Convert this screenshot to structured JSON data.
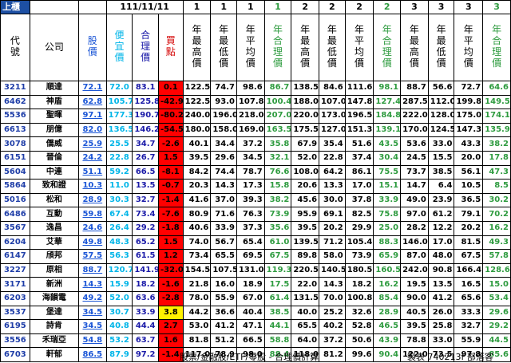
{
  "header": {
    "top_left": "上櫃",
    "date": "111/11/11",
    "groups": [
      {
        "num": "1",
        "cols": [
          "年最高價",
          "年最低價",
          "年平均價",
          "年合理價"
        ]
      },
      {
        "num": "2",
        "cols": [
          "年最高價",
          "年最低價",
          "年平均價",
          "年合理價"
        ]
      },
      {
        "num": "3",
        "cols": [
          "年最高價",
          "年最低價",
          "年平均價",
          "年合理價"
        ]
      }
    ],
    "group_nums": [
      "1",
      "1",
      "1",
      "1",
      "2",
      "2",
      "2",
      "2",
      "3",
      "3",
      "3",
      "3"
    ],
    "code": "代號",
    "company": "公司",
    "price": "股價",
    "cheap": "便宜價",
    "fair": "合理價",
    "signal": "買點"
  },
  "rows": [
    [
      "3211",
      "順達",
      "72.1",
      "72.0",
      "83.1",
      "0.1",
      "122.5",
      "74.7",
      "98.6",
      "86.7",
      "138.5",
      "84.6",
      "111.6",
      "98.1",
      "88.7",
      "56.6",
      "72.7",
      "64.6"
    ],
    [
      "6462",
      "神盾",
      "62.8",
      "105.7",
      "125.8",
      "-42.9",
      "122.5",
      "93.0",
      "107.8",
      "100.4",
      "188.0",
      "107.0",
      "147.8",
      "127.4",
      "287.5",
      "112.0",
      "199.8",
      "149.5"
    ],
    [
      "5536",
      "聖暉",
      "97.1",
      "177.3",
      "190.7",
      "-80.2",
      "240.0",
      "196.0",
      "218.0",
      "207.0",
      "220.0",
      "173.0",
      "196.5",
      "184.8",
      "222.0",
      "128.0",
      "175.0",
      "174.1"
    ],
    [
      "6613",
      "朋億",
      "82.0",
      "136.5",
      "146.2",
      "-54.5",
      "180.0",
      "158.0",
      "169.0",
      "163.5",
      "175.5",
      "127.0",
      "151.3",
      "139.1",
      "170.0",
      "124.5",
      "147.3",
      "135.9"
    ],
    [
      "3078",
      "僑威",
      "25.9",
      "25.5",
      "34.7",
      "-2.6",
      "40.1",
      "34.4",
      "37.2",
      "35.8",
      "67.9",
      "35.4",
      "51.6",
      "43.5",
      "53.6",
      "33.0",
      "43.3",
      "38.2"
    ],
    [
      "6151",
      "晉倫",
      "24.2",
      "22.8",
      "26.7",
      "1.5",
      "39.5",
      "29.6",
      "34.5",
      "32.1",
      "52.0",
      "22.8",
      "37.4",
      "30.4",
      "24.5",
      "15.5",
      "20.0",
      "17.8"
    ],
    [
      "5604",
      "中連",
      "51.1",
      "59.2",
      "66.5",
      "-8.1",
      "84.2",
      "74.4",
      "78.7",
      "76.6",
      "108.0",
      "64.2",
      "86.1",
      "75.5",
      "73.7",
      "38.5",
      "56.1",
      "47.3"
    ],
    [
      "5864",
      "致和證",
      "10.3",
      "11.0",
      "13.5",
      "-0.7",
      "20.3",
      "14.3",
      "17.3",
      "15.8",
      "20.6",
      "13.3",
      "17.0",
      "15.1",
      "14.7",
      "6.4",
      "10.5",
      "8.5"
    ],
    [
      "5016",
      "松和",
      "28.9",
      "30.3",
      "32.7",
      "-1.4",
      "41.6",
      "37.0",
      "39.3",
      "38.2",
      "45.6",
      "30.0",
      "37.8",
      "33.9",
      "49.0",
      "23.9",
      "36.5",
      "30.2"
    ],
    [
      "6486",
      "互動",
      "59.8",
      "67.4",
      "73.4",
      "-7.6",
      "80.9",
      "71.6",
      "76.3",
      "73.9",
      "95.9",
      "69.1",
      "82.5",
      "75.8",
      "97.0",
      "61.2",
      "79.1",
      "70.2"
    ],
    [
      "3567",
      "逸昌",
      "24.6",
      "26.4",
      "29.2",
      "-1.8",
      "40.6",
      "33.9",
      "37.3",
      "35.6",
      "39.5",
      "20.2",
      "29.9",
      "25.0",
      "28.2",
      "12.2",
      "20.2",
      "16.2"
    ],
    [
      "6204",
      "艾華",
      "49.8",
      "48.3",
      "65.2",
      "1.5",
      "74.0",
      "56.7",
      "65.4",
      "61.0",
      "139.5",
      "71.2",
      "105.4",
      "88.3",
      "146.0",
      "17.0",
      "81.5",
      "49.3"
    ],
    [
      "6147",
      "頎邦",
      "57.5",
      "56.3",
      "61.5",
      "1.2",
      "73.4",
      "65.5",
      "69.5",
      "67.5",
      "89.8",
      "58.0",
      "73.9",
      "65.9",
      "87.0",
      "48.0",
      "67.5",
      "57.8"
    ],
    [
      "3227",
      "原相",
      "88.7",
      "120.7",
      "141.9",
      "-32.0",
      "154.5",
      "107.5",
      "131.0",
      "119.3",
      "220.5",
      "140.5",
      "180.5",
      "160.5",
      "242.0",
      "90.8",
      "166.4",
      "128.6"
    ],
    [
      "3171",
      "新洲",
      "14.3",
      "15.9",
      "18.2",
      "-1.6",
      "21.8",
      "16.0",
      "18.9",
      "17.5",
      "22.0",
      "14.3",
      "18.2",
      "16.2",
      "19.5",
      "13.5",
      "16.5",
      "15.0"
    ],
    [
      "6203",
      "海韻電",
      "49.2",
      "52.0",
      "63.6",
      "-2.8",
      "78.0",
      "55.9",
      "67.0",
      "61.4",
      "131.5",
      "70.0",
      "100.8",
      "85.4",
      "90.0",
      "41.2",
      "65.6",
      "53.4"
    ],
    [
      "3537",
      "堡達",
      "34.5",
      "30.7",
      "33.9",
      "3.8",
      "44.2",
      "36.6",
      "40.4",
      "38.5",
      "40.0",
      "25.2",
      "32.6",
      "28.9",
      "40.5",
      "26.0",
      "33.3",
      "29.6"
    ],
    [
      "6195",
      "詩肯",
      "34.5",
      "40.8",
      "44.4",
      "2.7",
      "53.0",
      "41.2",
      "47.1",
      "44.1",
      "65.5",
      "40.2",
      "52.8",
      "46.5",
      "39.5",
      "25.8",
      "32.7",
      "29.2"
    ],
    [
      "3556",
      "禾瑞亞",
      "54.8",
      "53.2",
      "63.7",
      "1.6",
      "81.8",
      "51.2",
      "66.5",
      "58.8",
      "64.0",
      "37.2",
      "50.6",
      "43.9",
      "78.8",
      "33.0",
      "55.9",
      "44.5"
    ],
    [
      "6703",
      "軒郁",
      "86.5",
      "87.9",
      "97.2",
      "-1.4",
      "117.0",
      "78.9",
      "98.0",
      "88.4",
      "118.0",
      "81.2",
      "99.6",
      "90.4",
      "122.0",
      "73.5",
      "97.8",
      "85.6"
    ]
  ],
  "footer": {
    "left": "股票/金融股/ETF/零股 - 合理價計算",
    "right": "製表 740213f 部落客"
  },
  "colors": {
    "cheap": "#00b5e8",
    "signal_bg": "#ff0000",
    "signal_highlight": "#fff200",
    "green": "#2e9b3f"
  }
}
